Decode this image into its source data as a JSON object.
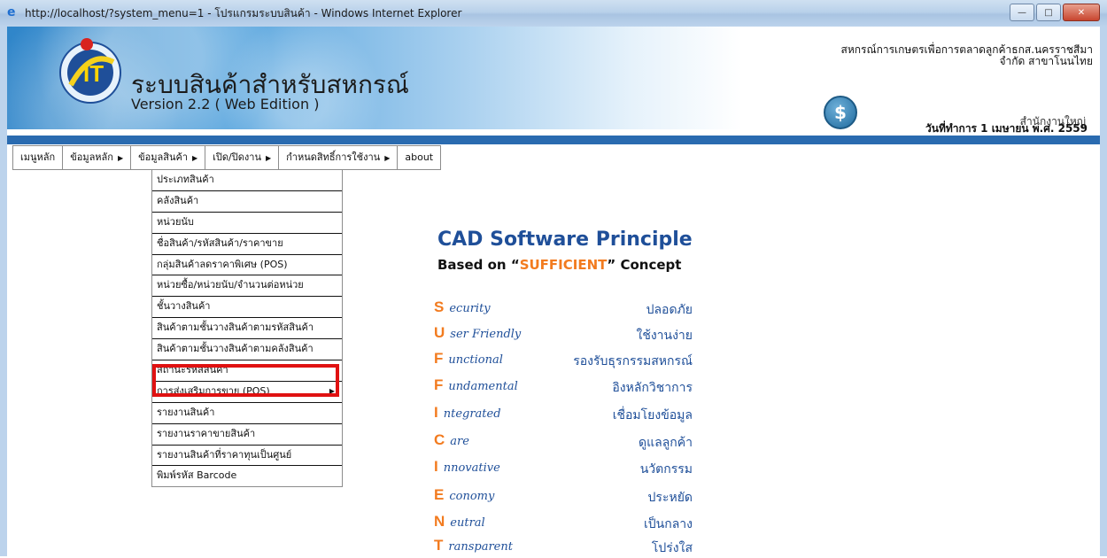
{
  "window": {
    "title": "http://localhost/?system_menu=1 - โปรแกรมระบบสินค้า - Windows Internet Explorer",
    "buttons": [
      "minimize",
      "maximize",
      "close"
    ]
  },
  "header": {
    "system_title": "ระบบสินค้าสำหรับสหกรณ์",
    "version": "Version 2.2 ( Web Edition )",
    "org_name_line1": "สหกรณ์การเกษตรเพื่อการตลาดลูกค้าธกส.นครราชสีมา",
    "org_name_line2": "จำกัด สาขาโนนไทย",
    "branch": "สำนักงานใหญ่",
    "work_date": "วันที่ทำการ 1 เมษายน พ.ศ. 2559"
  },
  "menubar": {
    "items": [
      {
        "label": "เมนูหลัก",
        "has_submenu": false
      },
      {
        "label": "ข้อมูลหลัก",
        "has_submenu": true
      },
      {
        "label": "ข้อมูลสินค้า",
        "has_submenu": true
      },
      {
        "label": "เปิด/ปิดงาน",
        "has_submenu": true
      },
      {
        "label": "กำหนดสิทธิ์การใช้งาน",
        "has_submenu": true
      },
      {
        "label": "about",
        "has_submenu": false
      }
    ]
  },
  "dropdown": {
    "items": [
      "ประเภทสินค้า",
      "คลังสินค้า",
      "หน่วยนับ",
      "ชื่อสินค้า/รหัสสินค้า/ราคาขาย",
      "กลุ่มสินค้าลดราคาพิเศษ (POS)",
      "หน่วยซื้อ/หน่วยนับ/จำนวนต่อหน่วย",
      "ชั้นวางสินค้า",
      "สินค้าตามชั้นวางสินค้าตามรหัสสินค้า",
      "สินค้าตามชั้นวางสินค้าตามคลังสินค้า",
      "สถานะรหัสสินค้า",
      "การส่งเสริมการขาย (POS)",
      "รายงานสินค้า",
      "รายงานราคาขายสินค้า",
      "รายงานสินค้าที่ราคาทุนเป็นศูนย์",
      "พิมพ์รหัส Barcode"
    ],
    "highlighted_item": "สินค้าตามชั้นวางสินค้าตามคลังสินค้า",
    "submenu_item": "การส่งเสริมการขาย (POS)"
  },
  "principle": {
    "title": "CAD Software Principle",
    "subtitle_prefix": "Based on “",
    "subtitle_highlight": "SUFFICIENT",
    "subtitle_suffix": "” Concept",
    "rows": [
      {
        "cap": "S",
        "rest": "ecurity",
        "th": "ปลอดภัย"
      },
      {
        "cap": "U",
        "rest": "ser Friendly",
        "th": "ใช้งานง่าย"
      },
      {
        "cap": "F",
        "rest": "unctional",
        "th": "รองรับธุรกรรมสหกรณ์"
      },
      {
        "cap": "F",
        "rest": "undamental",
        "th": "อิงหลักวิชาการ"
      },
      {
        "cap": "I",
        "rest": "ntegrated",
        "th": "เชื่อมโยงข้อมูล"
      },
      {
        "cap": "C",
        "rest": "are",
        "th": "ดูแลลูกค้า"
      },
      {
        "cap": "I",
        "rest": "nnovative",
        "th": "นวัตกรรม"
      },
      {
        "cap": "E",
        "rest": "conomy",
        "th": "ประหยัด"
      },
      {
        "cap": "N",
        "rest": "eutral",
        "th": "เป็นกลาง"
      },
      {
        "cap": "T",
        "rest": "ransparent",
        "th": "โปร่งใส"
      }
    ]
  },
  "colors": {
    "brand_blue": "#1f4f99",
    "accent_orange": "#f27b1f",
    "highlight_red": "#e01111",
    "bar_blue": "#2a6bb0"
  }
}
